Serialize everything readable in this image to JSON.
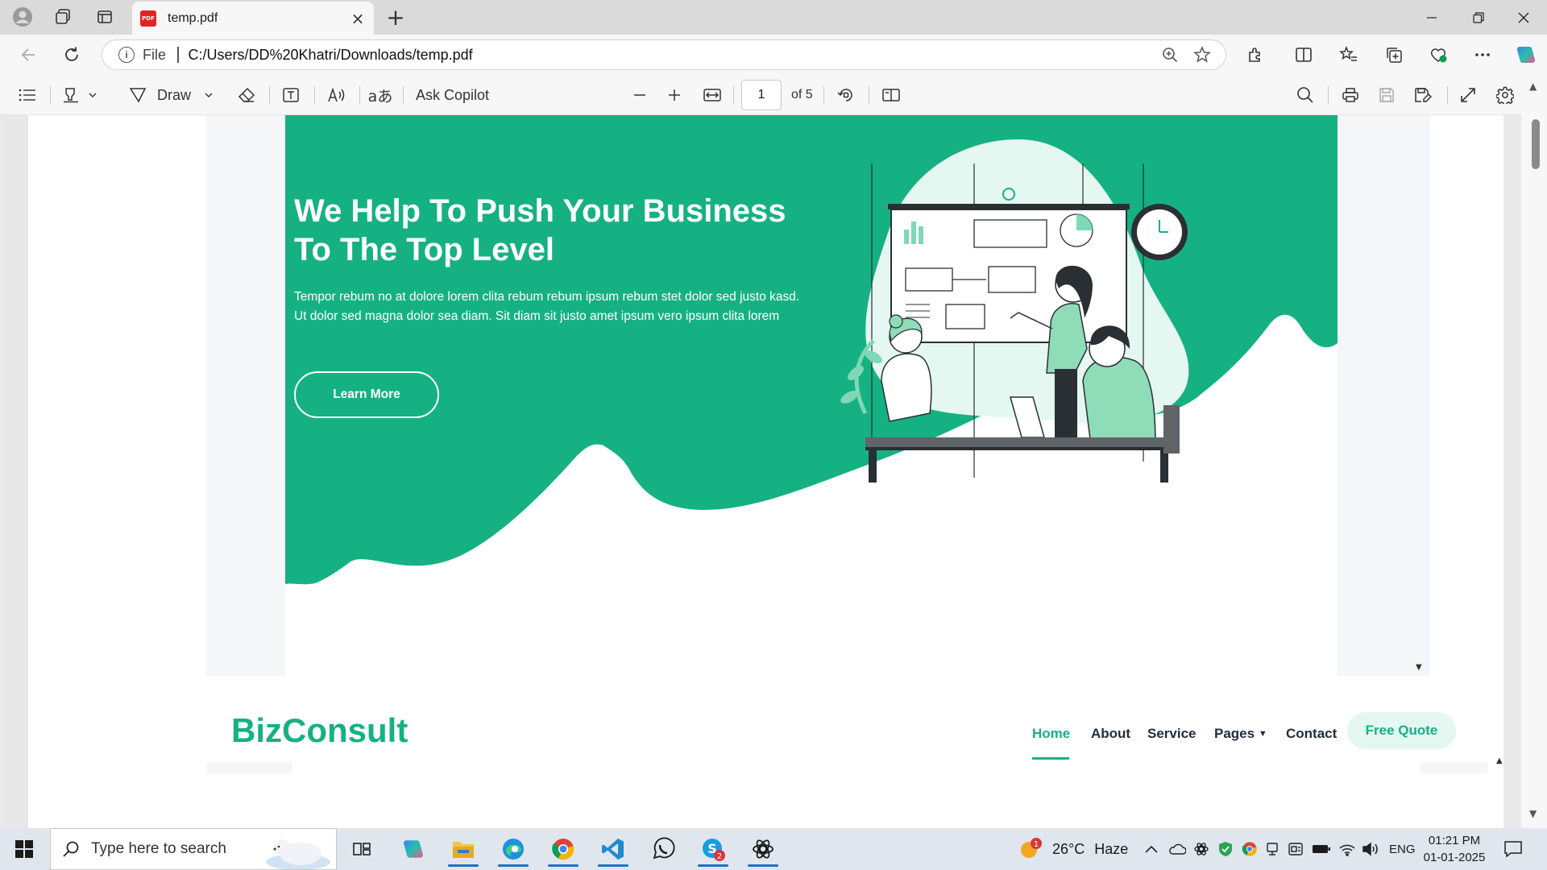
{
  "browser": {
    "tab": {
      "title": "temp.pdf",
      "icon": "pdf-file-icon"
    },
    "address": {
      "scheme_label": "File",
      "url": "C:/Users/DD%20Khatri/Downloads/temp.pdf"
    }
  },
  "pdf_toolbar": {
    "draw_label": "Draw",
    "ask_copilot_label": "Ask Copilot",
    "current_page": "1",
    "page_count_label": "of 5"
  },
  "document": {
    "hero": {
      "title": "We Help To Push Your Business To The Top Level",
      "text": "Tempor rebum no at dolore lorem clita rebum rebum ipsum rebum stet dolor sed justo kasd. Ut dolor sed magna dolor sea diam. Sit diam sit justo amet ipsum vero ipsum clita lorem",
      "button_label": "Learn More"
    },
    "navbar": {
      "brand": "BizConsult",
      "items": [
        {
          "label": "Home",
          "active": true
        },
        {
          "label": "About",
          "active": false
        },
        {
          "label": "Service",
          "active": false
        },
        {
          "label": "Pages",
          "active": false,
          "dropdown": true
        },
        {
          "label": "Contact",
          "active": false
        }
      ],
      "cta_label": "Free Quote"
    },
    "colors": {
      "brand_green": "#16b182",
      "light_green": "#e4f7f1"
    }
  },
  "taskbar": {
    "search_placeholder": "Type here to search",
    "weather": {
      "temperature": "26°C",
      "condition": "Haze",
      "alert_badge": "1"
    },
    "language": "ENG",
    "time": "01:21 PM",
    "date": "01-01-2025",
    "skype_badge": "2"
  }
}
